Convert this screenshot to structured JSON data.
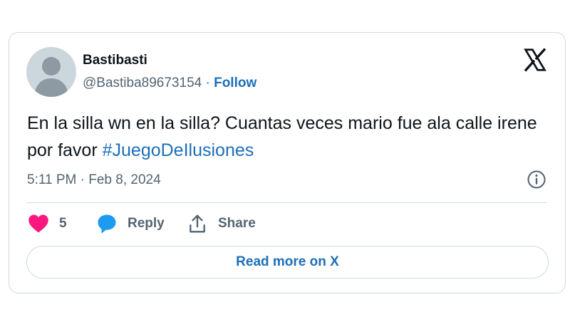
{
  "author": {
    "display_name": "Bastibasti",
    "handle": "@Bastiba89673154",
    "separator": " · ",
    "follow_label": "Follow"
  },
  "tweet": {
    "text": "En la silla wn en la silla? Cuantas veces mario fue ala calle irene por favor ",
    "hashtag": "#JuegoDeIlusiones",
    "timestamp": "5:11 PM · Feb 8, 2024"
  },
  "actions": {
    "like_count": "5",
    "reply_label": "Reply",
    "share_label": "Share"
  },
  "read_more_label": "Read more on X",
  "colors": {
    "accent": "#1d6fb8",
    "like": "#f91880",
    "reply": "#1d9bf0",
    "muted": "#536471",
    "border": "#cfd9de"
  },
  "icons": [
    "x-logo-icon",
    "info-icon",
    "heart-icon",
    "reply-bubble-icon",
    "share-icon",
    "default-avatar-icon"
  ]
}
